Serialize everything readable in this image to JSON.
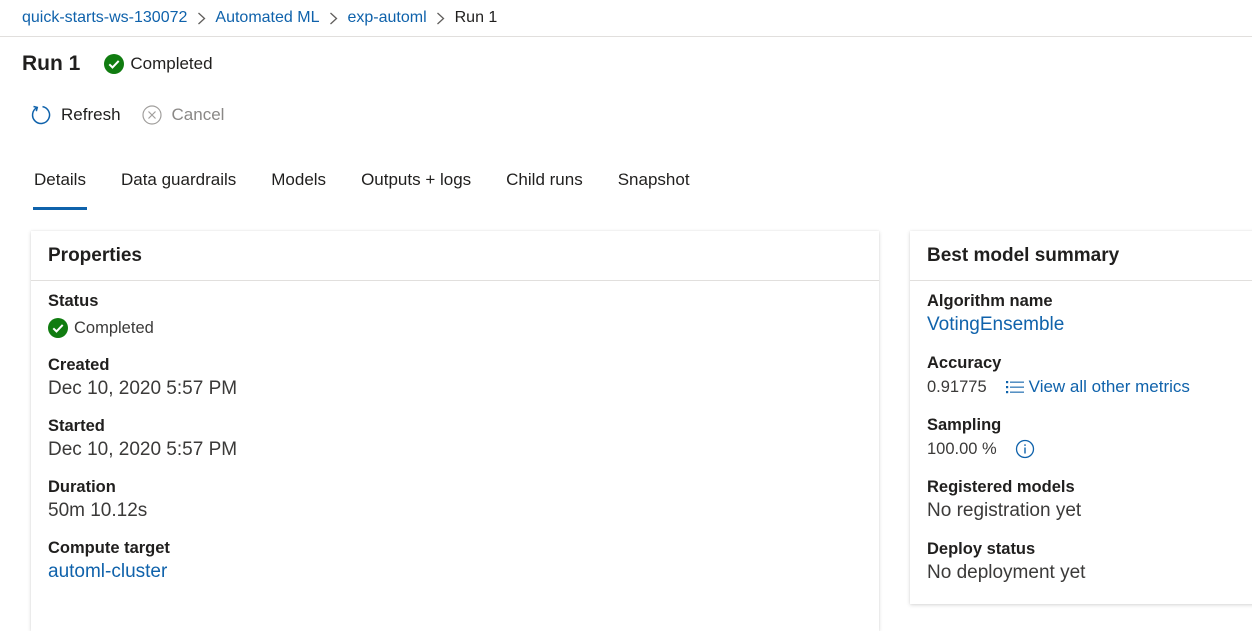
{
  "breadcrumb": {
    "items": [
      "quick-starts-ws-130072",
      "Automated ML",
      "exp-automl",
      "Run 1"
    ]
  },
  "header": {
    "title": "Run 1",
    "status": "Completed"
  },
  "toolbar": {
    "refresh_label": "Refresh",
    "cancel_label": "Cancel"
  },
  "tabs": [
    "Details",
    "Data guardrails",
    "Models",
    "Outputs + logs",
    "Child runs",
    "Snapshot"
  ],
  "properties": {
    "title": "Properties",
    "status_label": "Status",
    "status_value": "Completed",
    "created_label": "Created",
    "created_value": "Dec 10, 2020 5:57 PM",
    "started_label": "Started",
    "started_value": "Dec 10, 2020 5:57 PM",
    "duration_label": "Duration",
    "duration_value": "50m 10.12s",
    "compute_label": "Compute target",
    "compute_value": "automl-cluster"
  },
  "best_model": {
    "title": "Best model summary",
    "algorithm_label": "Algorithm name",
    "algorithm_value": "VotingEnsemble",
    "accuracy_label": "Accuracy",
    "accuracy_value": "0.91775",
    "metrics_link": "View all other metrics",
    "sampling_label": "Sampling",
    "sampling_value": "100.00 %",
    "registered_label": "Registered models",
    "registered_value": "No registration yet",
    "deploy_label": "Deploy status",
    "deploy_value": "No deployment yet"
  },
  "colors": {
    "link": "#0f62ab",
    "success": "#107c10",
    "disabled": "#8a8886"
  }
}
